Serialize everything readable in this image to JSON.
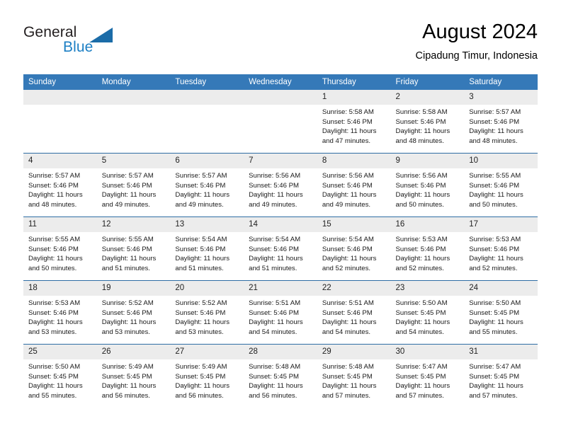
{
  "brand": {
    "name_part1": "General",
    "name_part2": "Blue",
    "logo_icon": "triangle-icon"
  },
  "header": {
    "title": "August 2024",
    "subtitle": "Cipadung Timur, Indonesia"
  },
  "calendar": {
    "accent_color": "#3579b8",
    "daynum_bg": "#ececec",
    "weekday_headers": [
      "Sunday",
      "Monday",
      "Tuesday",
      "Wednesday",
      "Thursday",
      "Friday",
      "Saturday"
    ],
    "weeks": [
      [
        {
          "day": "",
          "empty": true
        },
        {
          "day": "",
          "empty": true
        },
        {
          "day": "",
          "empty": true
        },
        {
          "day": "",
          "empty": true
        },
        {
          "day": "1",
          "sunrise": "Sunrise: 5:58 AM",
          "sunset": "Sunset: 5:46 PM",
          "daylight": "Daylight: 11 hours and 47 minutes."
        },
        {
          "day": "2",
          "sunrise": "Sunrise: 5:58 AM",
          "sunset": "Sunset: 5:46 PM",
          "daylight": "Daylight: 11 hours and 48 minutes."
        },
        {
          "day": "3",
          "sunrise": "Sunrise: 5:57 AM",
          "sunset": "Sunset: 5:46 PM",
          "daylight": "Daylight: 11 hours and 48 minutes."
        }
      ],
      [
        {
          "day": "4",
          "sunrise": "Sunrise: 5:57 AM",
          "sunset": "Sunset: 5:46 PM",
          "daylight": "Daylight: 11 hours and 48 minutes."
        },
        {
          "day": "5",
          "sunrise": "Sunrise: 5:57 AM",
          "sunset": "Sunset: 5:46 PM",
          "daylight": "Daylight: 11 hours and 49 minutes."
        },
        {
          "day": "6",
          "sunrise": "Sunrise: 5:57 AM",
          "sunset": "Sunset: 5:46 PM",
          "daylight": "Daylight: 11 hours and 49 minutes."
        },
        {
          "day": "7",
          "sunrise": "Sunrise: 5:56 AM",
          "sunset": "Sunset: 5:46 PM",
          "daylight": "Daylight: 11 hours and 49 minutes."
        },
        {
          "day": "8",
          "sunrise": "Sunrise: 5:56 AM",
          "sunset": "Sunset: 5:46 PM",
          "daylight": "Daylight: 11 hours and 49 minutes."
        },
        {
          "day": "9",
          "sunrise": "Sunrise: 5:56 AM",
          "sunset": "Sunset: 5:46 PM",
          "daylight": "Daylight: 11 hours and 50 minutes."
        },
        {
          "day": "10",
          "sunrise": "Sunrise: 5:55 AM",
          "sunset": "Sunset: 5:46 PM",
          "daylight": "Daylight: 11 hours and 50 minutes."
        }
      ],
      [
        {
          "day": "11",
          "sunrise": "Sunrise: 5:55 AM",
          "sunset": "Sunset: 5:46 PM",
          "daylight": "Daylight: 11 hours and 50 minutes."
        },
        {
          "day": "12",
          "sunrise": "Sunrise: 5:55 AM",
          "sunset": "Sunset: 5:46 PM",
          "daylight": "Daylight: 11 hours and 51 minutes."
        },
        {
          "day": "13",
          "sunrise": "Sunrise: 5:54 AM",
          "sunset": "Sunset: 5:46 PM",
          "daylight": "Daylight: 11 hours and 51 minutes."
        },
        {
          "day": "14",
          "sunrise": "Sunrise: 5:54 AM",
          "sunset": "Sunset: 5:46 PM",
          "daylight": "Daylight: 11 hours and 51 minutes."
        },
        {
          "day": "15",
          "sunrise": "Sunrise: 5:54 AM",
          "sunset": "Sunset: 5:46 PM",
          "daylight": "Daylight: 11 hours and 52 minutes."
        },
        {
          "day": "16",
          "sunrise": "Sunrise: 5:53 AM",
          "sunset": "Sunset: 5:46 PM",
          "daylight": "Daylight: 11 hours and 52 minutes."
        },
        {
          "day": "17",
          "sunrise": "Sunrise: 5:53 AM",
          "sunset": "Sunset: 5:46 PM",
          "daylight": "Daylight: 11 hours and 52 minutes."
        }
      ],
      [
        {
          "day": "18",
          "sunrise": "Sunrise: 5:53 AM",
          "sunset": "Sunset: 5:46 PM",
          "daylight": "Daylight: 11 hours and 53 minutes."
        },
        {
          "day": "19",
          "sunrise": "Sunrise: 5:52 AM",
          "sunset": "Sunset: 5:46 PM",
          "daylight": "Daylight: 11 hours and 53 minutes."
        },
        {
          "day": "20",
          "sunrise": "Sunrise: 5:52 AM",
          "sunset": "Sunset: 5:46 PM",
          "daylight": "Daylight: 11 hours and 53 minutes."
        },
        {
          "day": "21",
          "sunrise": "Sunrise: 5:51 AM",
          "sunset": "Sunset: 5:46 PM",
          "daylight": "Daylight: 11 hours and 54 minutes."
        },
        {
          "day": "22",
          "sunrise": "Sunrise: 5:51 AM",
          "sunset": "Sunset: 5:46 PM",
          "daylight": "Daylight: 11 hours and 54 minutes."
        },
        {
          "day": "23",
          "sunrise": "Sunrise: 5:50 AM",
          "sunset": "Sunset: 5:45 PM",
          "daylight": "Daylight: 11 hours and 54 minutes."
        },
        {
          "day": "24",
          "sunrise": "Sunrise: 5:50 AM",
          "sunset": "Sunset: 5:45 PM",
          "daylight": "Daylight: 11 hours and 55 minutes."
        }
      ],
      [
        {
          "day": "25",
          "sunrise": "Sunrise: 5:50 AM",
          "sunset": "Sunset: 5:45 PM",
          "daylight": "Daylight: 11 hours and 55 minutes."
        },
        {
          "day": "26",
          "sunrise": "Sunrise: 5:49 AM",
          "sunset": "Sunset: 5:45 PM",
          "daylight": "Daylight: 11 hours and 56 minutes."
        },
        {
          "day": "27",
          "sunrise": "Sunrise: 5:49 AM",
          "sunset": "Sunset: 5:45 PM",
          "daylight": "Daylight: 11 hours and 56 minutes."
        },
        {
          "day": "28",
          "sunrise": "Sunrise: 5:48 AM",
          "sunset": "Sunset: 5:45 PM",
          "daylight": "Daylight: 11 hours and 56 minutes."
        },
        {
          "day": "29",
          "sunrise": "Sunrise: 5:48 AM",
          "sunset": "Sunset: 5:45 PM",
          "daylight": "Daylight: 11 hours and 57 minutes."
        },
        {
          "day": "30",
          "sunrise": "Sunrise: 5:47 AM",
          "sunset": "Sunset: 5:45 PM",
          "daylight": "Daylight: 11 hours and 57 minutes."
        },
        {
          "day": "31",
          "sunrise": "Sunrise: 5:47 AM",
          "sunset": "Sunset: 5:45 PM",
          "daylight": "Daylight: 11 hours and 57 minutes."
        }
      ]
    ]
  }
}
